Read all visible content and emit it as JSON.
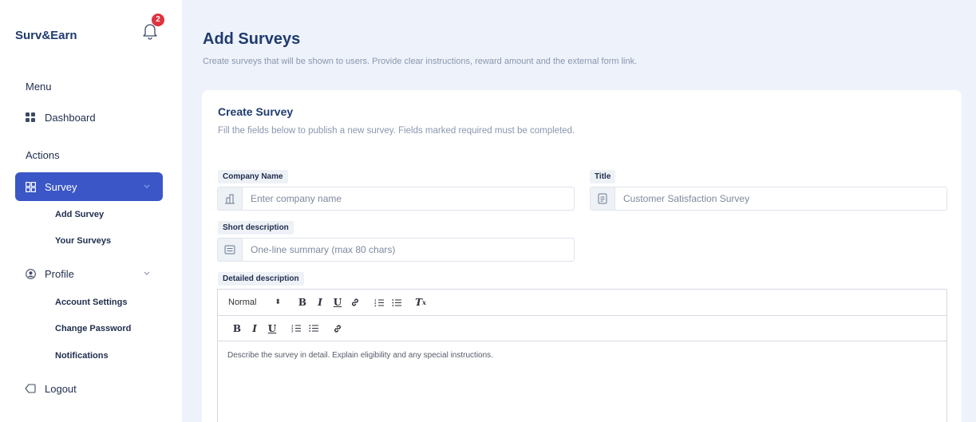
{
  "app": {
    "brand": "Surv&Earn",
    "notification_count": "2"
  },
  "sidebar": {
    "menu_label": "Menu",
    "actions_label": "Actions",
    "dashboard_label": "Dashboard",
    "survey_label": "Survey",
    "survey_children": [
      "Add Survey",
      "Your Surveys"
    ],
    "profile_label": "Profile",
    "profile_children": [
      "Account Settings",
      "Change Password",
      "Notifications"
    ],
    "logout_label": "Logout"
  },
  "page": {
    "title": "Add Surveys",
    "subtitle": "Create surveys that will be shown to users. Provide clear instructions, reward amount and the external form link."
  },
  "card": {
    "title": "Create Survey",
    "subtitle": "Fill the fields below to publish a new survey. Fields marked required must be completed."
  },
  "form": {
    "company_label": "Company Name",
    "company_placeholder": "Enter company name",
    "title_label": "Title",
    "title_placeholder": "Customer Satisfaction Survey",
    "short_desc_label": "Short description",
    "short_desc_placeholder": "One-line summary (max 80 chars)",
    "detailed_label": "Detailed description",
    "editor_format": "Normal",
    "editor_placeholder": "Describe the survey in detail. Explain eligibility and any special instructions."
  },
  "colors": {
    "accent": "#3a56c7",
    "badge": "#e0323e",
    "brand": "#1f3b6e"
  }
}
